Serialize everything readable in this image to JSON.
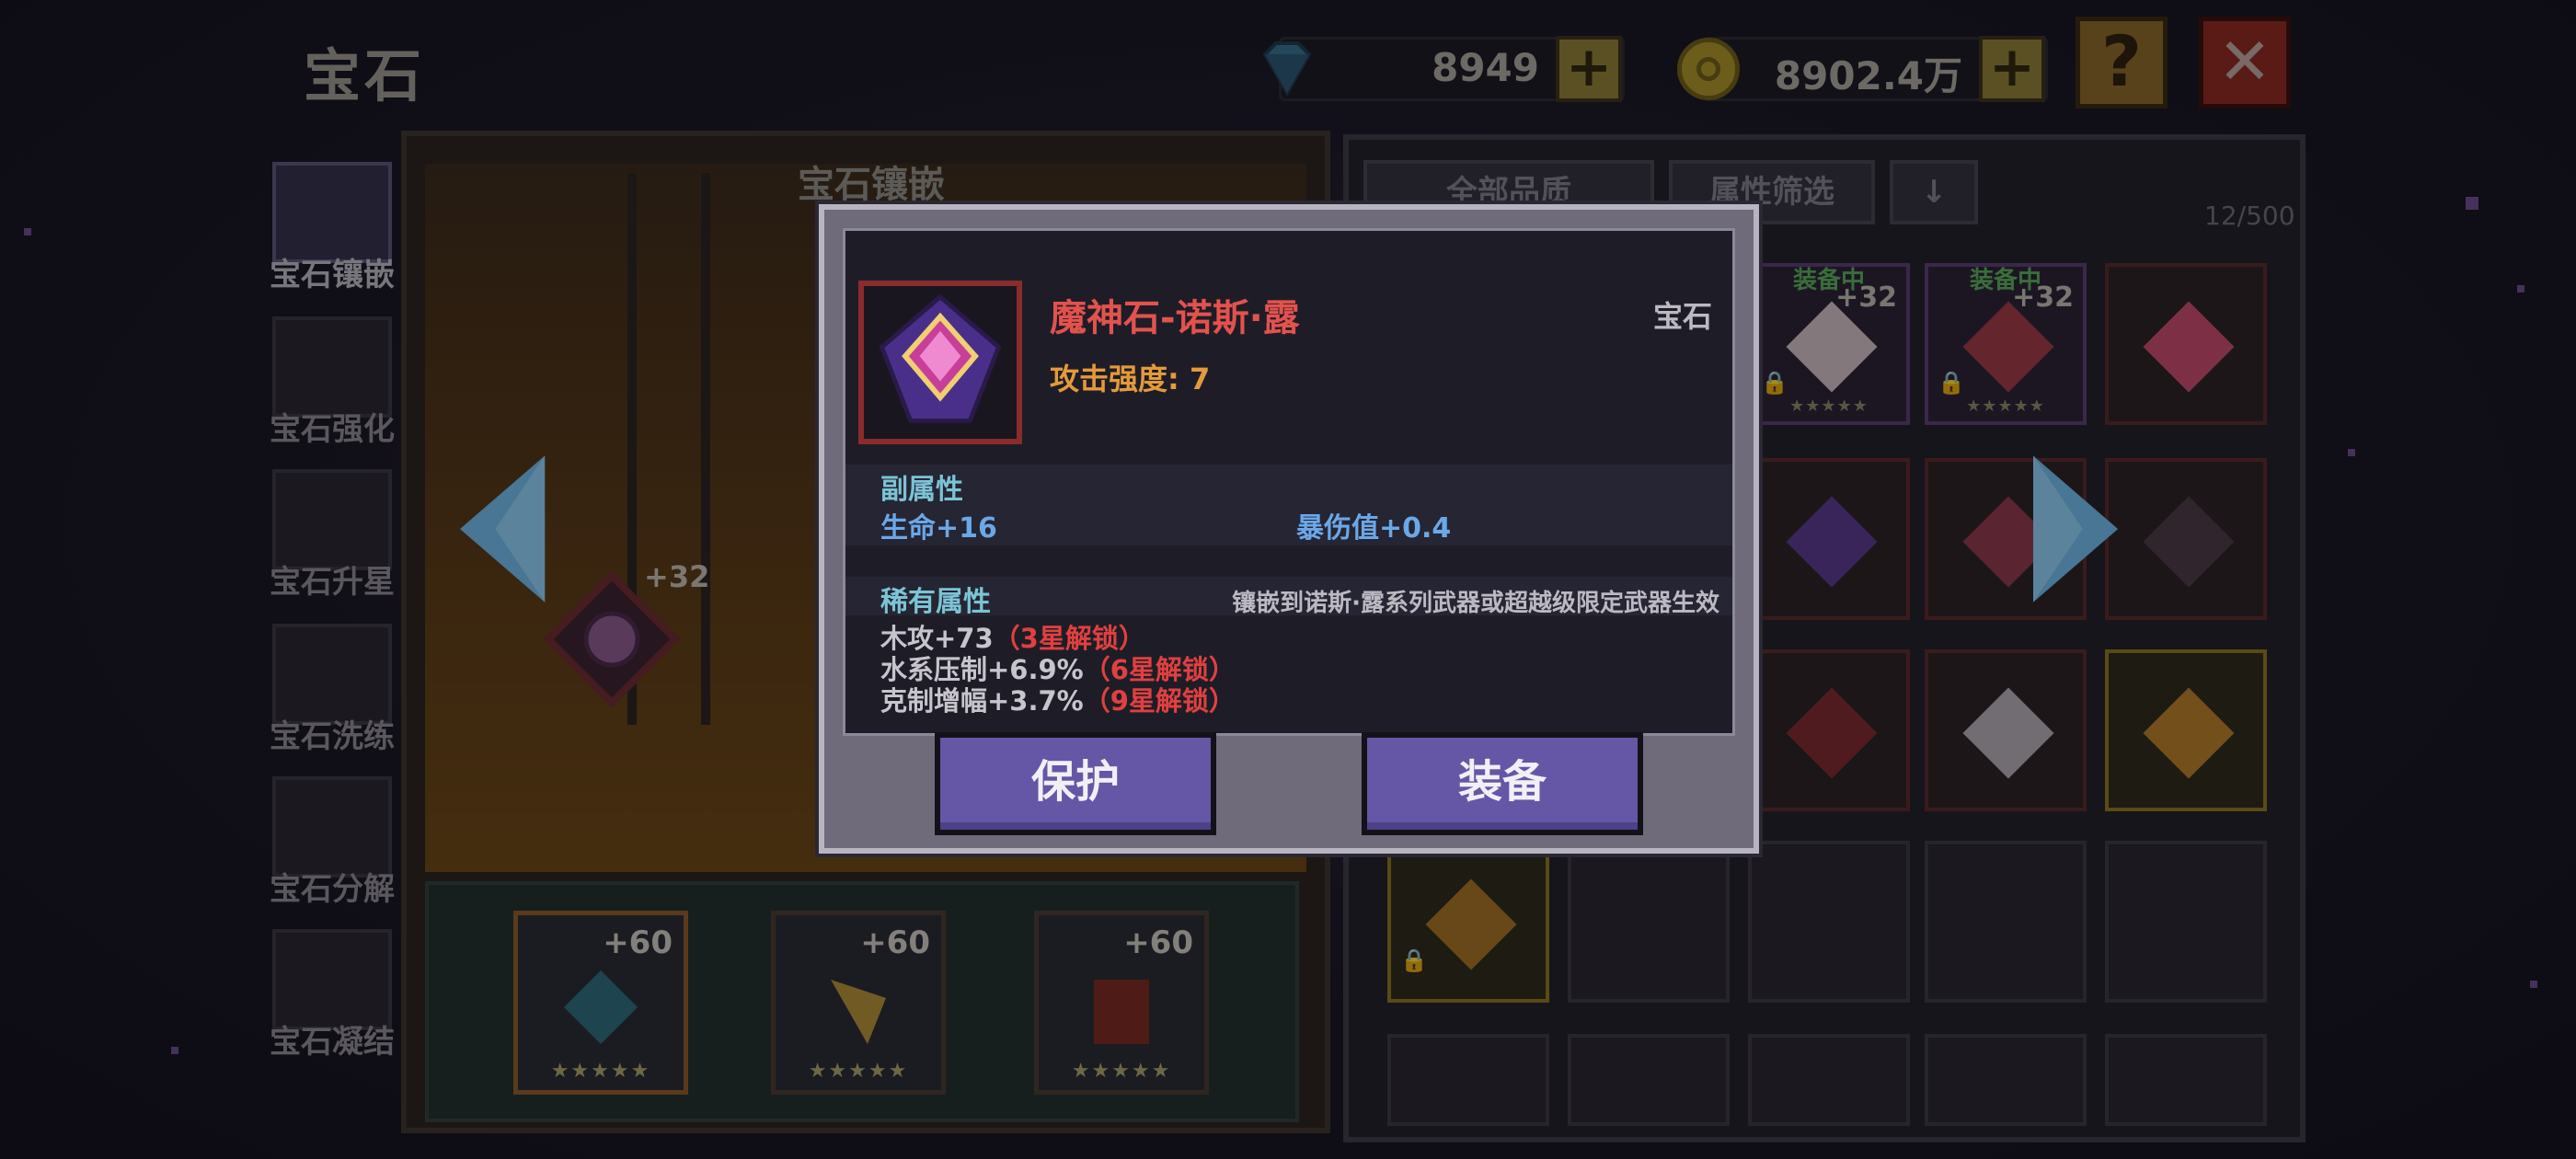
{
  "header": {
    "title": "宝石",
    "diamonds": "8949",
    "gold": "8902.4万",
    "help_glyph": "?",
    "close_glyph": "✕",
    "plus_glyph": "+"
  },
  "nav": {
    "items": [
      {
        "label": "宝石镶嵌",
        "icon": "gem-socket-icon",
        "active": true
      },
      {
        "label": "宝石强化",
        "icon": "gem-enhance-icon",
        "active": false
      },
      {
        "label": "宝石升星",
        "icon": "star-up-icon",
        "active": false
      },
      {
        "label": "宝石洗练",
        "icon": "gem-refine-icon",
        "active": false
      },
      {
        "label": "宝石分解",
        "icon": "gem-decompose-icon",
        "active": false
      },
      {
        "label": "宝石凝结",
        "icon": "gem-condense-icon",
        "active": false
      }
    ]
  },
  "socket": {
    "title": "宝石镶嵌",
    "gem_plus": "+32",
    "slots": [
      {
        "plus": "+60",
        "stars": "★★★★★"
      },
      {
        "plus": "+60",
        "stars": "★★★★★"
      },
      {
        "plus": "+60",
        "stars": "★★★★★"
      }
    ]
  },
  "inventory": {
    "filter_quality": "全部品质",
    "filter_attr": "属性筛选",
    "sort_glyph": "↓",
    "count": "12/500",
    "equipped_tag": "装备中",
    "cell_plus": "+32",
    "stars": "★★★★★"
  },
  "modal": {
    "item_name": "魔神石-诺斯·露",
    "item_type": "宝石",
    "attack_label": "攻击强度: 7",
    "sub_attr_header": "副属性",
    "sub_attr_1": "生命+16",
    "sub_attr_2": "暴伤值+0.4",
    "rare_attr_header": "稀有属性",
    "rare_note": "镶嵌到诺斯·露系列武器或超越级限定武器生效",
    "rare_1": "木攻+73",
    "rare_1_lock": "（3星解锁）",
    "rare_2": "水系压制+6.9%",
    "rare_2_lock": "（6星解锁）",
    "rare_3": "克制增幅+3.7%",
    "rare_3_lock": "（9星解锁）",
    "protect_button": "保护",
    "equip_button": "装备"
  },
  "colors": {
    "item_name": "#e3524d",
    "attack_stat": "#e49a3a",
    "section_header": "#7cc3d6",
    "sub_stat": "#6aa8e8",
    "locked": "#e04040",
    "button": "#6557a6",
    "arrow": "#6fb6e4"
  }
}
